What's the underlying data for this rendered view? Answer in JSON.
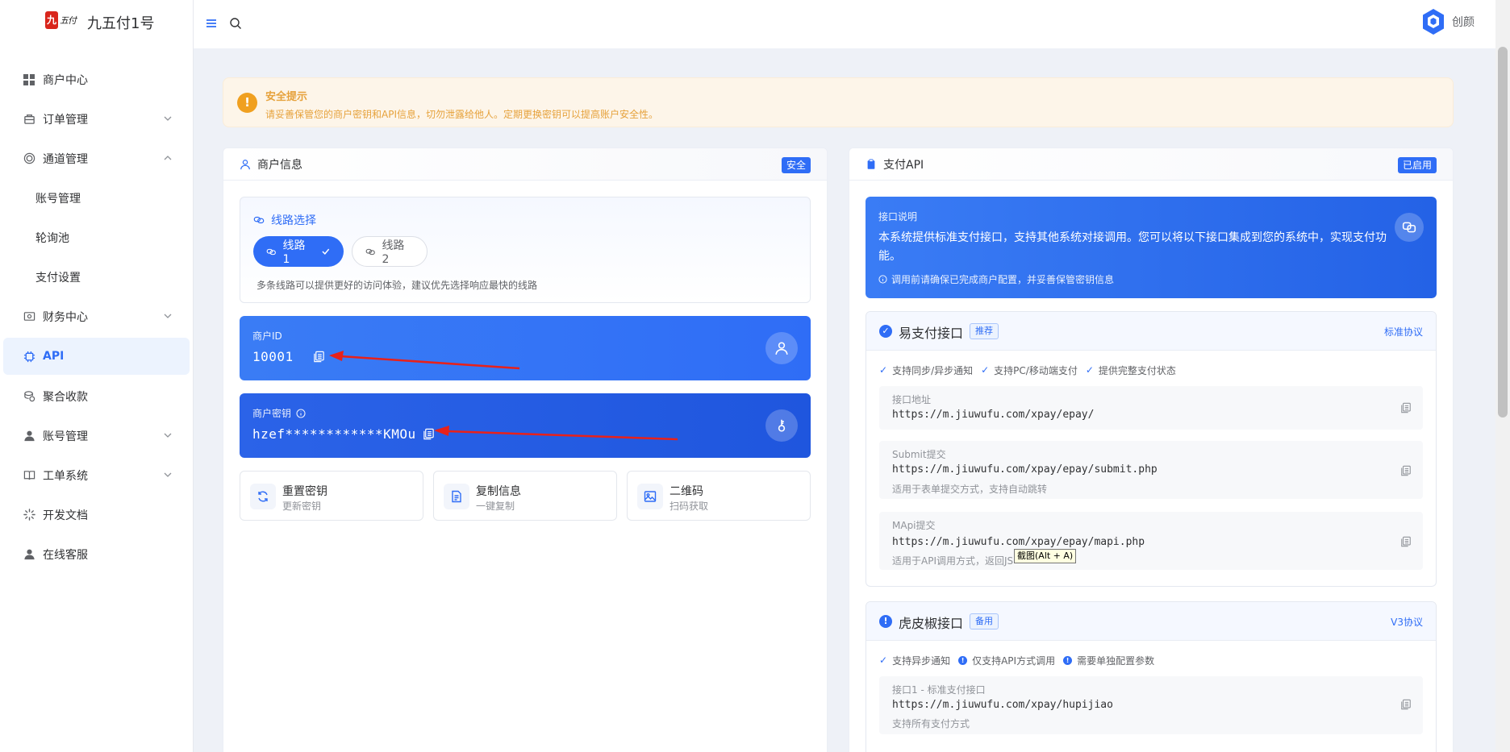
{
  "app": {
    "logo_seal": "九",
    "logo_script": "五付",
    "title": "九五付1号",
    "brand_name": "创颜"
  },
  "sidebar": {
    "items": [
      {
        "label": "商户中心",
        "icon": "grid-icon"
      },
      {
        "label": "订单管理",
        "icon": "bag-icon"
      },
      {
        "label": "通道管理",
        "icon": "channel-icon"
      },
      {
        "label": "账号管理",
        "icon": ""
      },
      {
        "label": "轮询池",
        "icon": ""
      },
      {
        "label": "支付设置",
        "icon": ""
      },
      {
        "label": "财务中心",
        "icon": "wallet-icon"
      },
      {
        "label": "API",
        "icon": "chip-icon"
      },
      {
        "label": "聚合收款",
        "icon": "coins-icon"
      },
      {
        "label": "账号管理",
        "icon": "user-icon"
      },
      {
        "label": "工单系统",
        "icon": "book-icon"
      },
      {
        "label": "开发文档",
        "icon": "spinner-icon"
      },
      {
        "label": "在线客服",
        "icon": "user-icon"
      }
    ]
  },
  "alert": {
    "title": "安全提示",
    "text": "请妥善保管您的商户密钥和API信息，切勿泄露给他人。定期更换密钥可以提高账户安全性。"
  },
  "merchant": {
    "header": "商户信息",
    "badge": "安全",
    "route_title": "线路选择",
    "route1": "线路 1",
    "route2": "线路 2",
    "route_note": "多条线路可以提供更好的访问体验，建议优先选择响应最快的线路",
    "id_label": "商户ID",
    "id_value": "10001",
    "key_label": "商户密钥",
    "key_value": "hzef************KMOu",
    "actions": [
      {
        "title": "重置密钥",
        "sub": "更新密钥"
      },
      {
        "title": "复制信息",
        "sub": "一键复制"
      },
      {
        "title": "二维码",
        "sub": "扫码获取"
      }
    ]
  },
  "api": {
    "header": "支付API",
    "badge": "已启用",
    "intro_title": "接口说明",
    "intro_text": "本系统提供标准支付接口，支持其他系统对接调用。您可以将以下接口集成到您的系统中，实现支付功能。",
    "intro_note": "调用前请确保已完成商户配置，并妥善保管密钥信息",
    "epay": {
      "title": "易支付接口",
      "tag": "推荐",
      "protocol": "标准协议",
      "features": [
        "支持同步/异步通知",
        "支持PC/移动端支付",
        "提供完整支付状态"
      ],
      "endpoints": [
        {
          "label": "接口地址",
          "url": "https://m.jiuwufu.com/xpay/epay/",
          "desc": ""
        },
        {
          "label": "Submit提交",
          "url": "https://m.jiuwufu.com/xpay/epay/submit.php",
          "desc": "适用于表单提交方式，支持自动跳转"
        },
        {
          "label": "MApi提交",
          "url": "https://m.jiuwufu.com/xpay/epay/mapi.php",
          "desc": "适用于API调用方式，返回JS"
        }
      ]
    },
    "hupi": {
      "title": "虎皮椒接口",
      "tag": "备用",
      "protocol": "V3协议",
      "features": [
        "支持异步通知",
        "仅支持API方式调用",
        "需要单独配置参数"
      ],
      "endpoints": [
        {
          "label": "接口1 - 标准支付接口",
          "url": "https://m.jiuwufu.com/xpay/hupijiao",
          "desc": "支持所有支付方式"
        }
      ]
    }
  },
  "tooltip": "截图(Alt + A)",
  "colors": {
    "primary": "#2f6df6",
    "warning": "#e6a23c"
  }
}
